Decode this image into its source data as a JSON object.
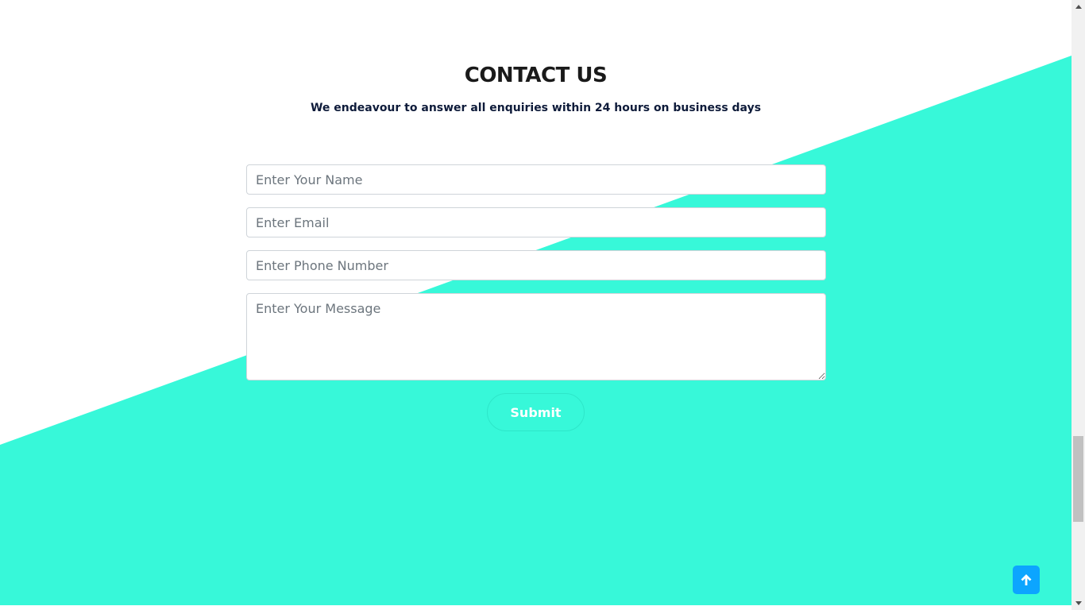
{
  "contact": {
    "title": "CONTACT US",
    "subtitle": "We endeavour to answer all enquiries within 24 hours on business days",
    "name_placeholder": "Enter Your Name",
    "email_placeholder": "Enter Email",
    "phone_placeholder": "Enter Phone Number",
    "message_placeholder": "Enter Your Message",
    "submit_label": "Submit"
  },
  "colors": {
    "accent": "#37f8d9",
    "back_to_top": "#0ca5ff",
    "title": "#1a1a1a",
    "subtitle": "#0e1b3a"
  },
  "icons": {
    "back_to_top": "arrow-up-icon",
    "scroll_up": "triangle-up-icon",
    "scroll_down": "triangle-down-icon"
  }
}
